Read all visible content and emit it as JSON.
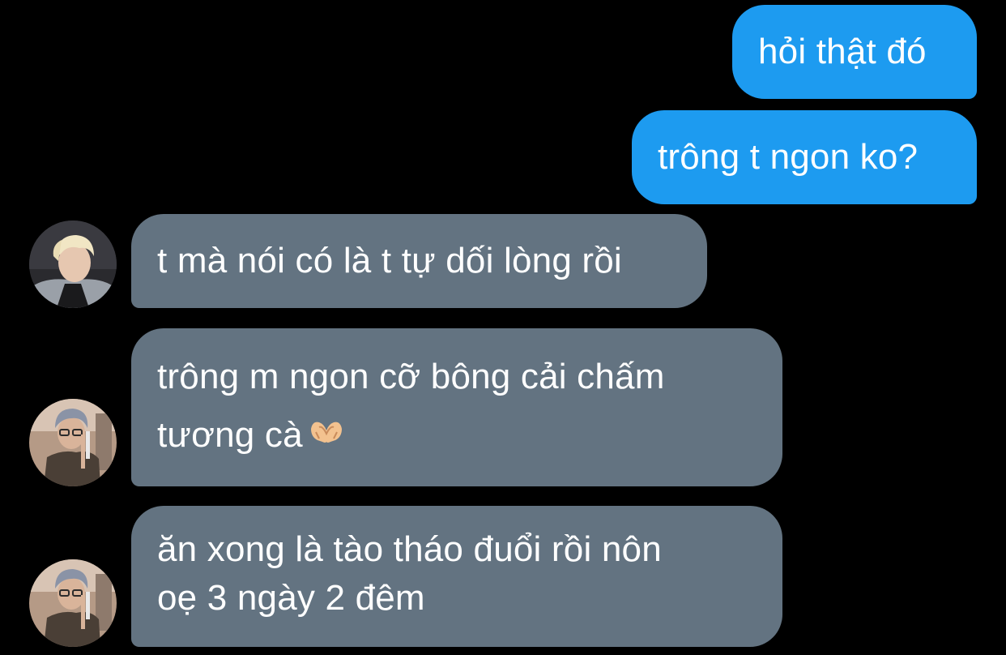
{
  "conversation": {
    "messages": [
      {
        "direction": "sent",
        "lines": [
          "hỏi thật đó"
        ]
      },
      {
        "direction": "sent",
        "lines": [
          "trông t ngon ko?"
        ]
      },
      {
        "direction": "received",
        "avatar": "avatar-blonde",
        "lines": [
          "t mà nói có là t tự dối lòng rồi"
        ]
      },
      {
        "direction": "received",
        "avatar": "avatar-gray-hair",
        "lines": [
          "trông m ngon cỡ bông cải chấm",
          "tương cà"
        ],
        "emoji": "heart-hands-emoji"
      },
      {
        "direction": "received",
        "avatar": "avatar-gray-hair",
        "lines": [
          "ăn xong là tào tháo đuổi rồi nôn",
          "oẹ 3 ngày 2 đêm"
        ]
      }
    ]
  },
  "colors": {
    "background": "#000000",
    "sent_bubble": "#1d9bf0",
    "received_bubble": "#637381",
    "text": "#ffffff"
  }
}
